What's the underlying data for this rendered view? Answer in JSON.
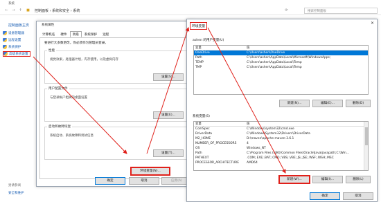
{
  "control_panel": {
    "window_title": "系统",
    "breadcrumb": "控制面板 › 系统和安全 › 系统",
    "search_placeholder": "搜索控制面板",
    "home_link": "控制面板主页",
    "left_items": [
      {
        "label": "设备管理器",
        "icon": "shield-icon"
      },
      {
        "label": "远程设置",
        "icon": "shield-icon"
      },
      {
        "label": "系统保护",
        "icon": "shield-icon"
      },
      {
        "label": "高级系统设置",
        "icon": "shield-icon"
      }
    ],
    "see_also": "另请参阅",
    "security_link": "安全和维护"
  },
  "system_properties": {
    "title": "系统属性",
    "tabs": [
      "计算机名",
      "硬件",
      "高级",
      "系统保护",
      "远程"
    ],
    "active_tab": "高级",
    "note": "要进行大多数更改，你必须作为管理员登录。",
    "performance": {
      "title": "性能",
      "desc": "视觉效果，处理器计划，内存使用，以及虚拟内存",
      "button": "设置(S)..."
    },
    "user_profiles": {
      "title": "用户配置文件",
      "desc": "与登录帐户相关的桌面设置",
      "button": "设置(E)..."
    },
    "startup": {
      "title": "启动和故障恢复",
      "desc": "系统启动、系统故障和调试信息",
      "button": "设置(T)..."
    },
    "env_button": "环境变量(N)...",
    "ok": "确定",
    "cancel": "取消",
    "apply": "应用(A)"
  },
  "env_vars": {
    "title": "环境变量",
    "user_section": "ashen 的用户变量(U)",
    "columns": {
      "var": "变量",
      "val": "值"
    },
    "user_vars": [
      {
        "var": "OneDrive",
        "val": "C:\\Users\\ashen\\OneDrive"
      },
      {
        "var": "Path",
        "val": "C:\\Users\\ashen\\AppData\\Local\\Microsoft\\WindowsApps;"
      },
      {
        "var": "TEMP",
        "val": "C:\\Users\\ashen\\AppData\\Local\\Temp"
      },
      {
        "var": "TMP",
        "val": "C:\\Users\\ashen\\AppData\\Local\\Temp"
      }
    ],
    "user_buttons": {
      "new": "新建(N)...",
      "edit": "编辑(E)...",
      "delete": "删除(D)"
    },
    "system_section": "系统变量(S)",
    "system_vars": [
      {
        "var": "ComSpec",
        "val": "C:\\Windows\\system32\\cmd.exe"
      },
      {
        "var": "DriverData",
        "val": "C:\\Windows\\System32\\Drivers\\DriverData"
      },
      {
        "var": "M2_HOME",
        "val": "D:\\maven\\apache-maven-3.6.1"
      },
      {
        "var": "NUMBER_OF_PROCESSORS",
        "val": "4"
      },
      {
        "var": "OS",
        "val": "Windows_NT"
      },
      {
        "var": "Path",
        "val": "C:\\Program Files (x86)\\Common Files\\Oracle\\Java\\javapath;C:\\Win..."
      },
      {
        "var": "PATHEXT",
        "val": ".COM;.EXE;.BAT;.CMD;.VBS;.VBE;.JS;.JSE;.WSF;.WSH;.MSC"
      },
      {
        "var": "PROCESSOR_ARCHITECTURE",
        "val": "AMD64"
      }
    ],
    "system_buttons": {
      "new": "新建(W)...",
      "edit": "编辑(I)...",
      "delete": "删除(L)"
    },
    "ok": "确定",
    "cancel": "取消"
  },
  "colors": {
    "highlight": "#e0201a",
    "selection": "#0078d7",
    "link": "#1a5fb4"
  }
}
